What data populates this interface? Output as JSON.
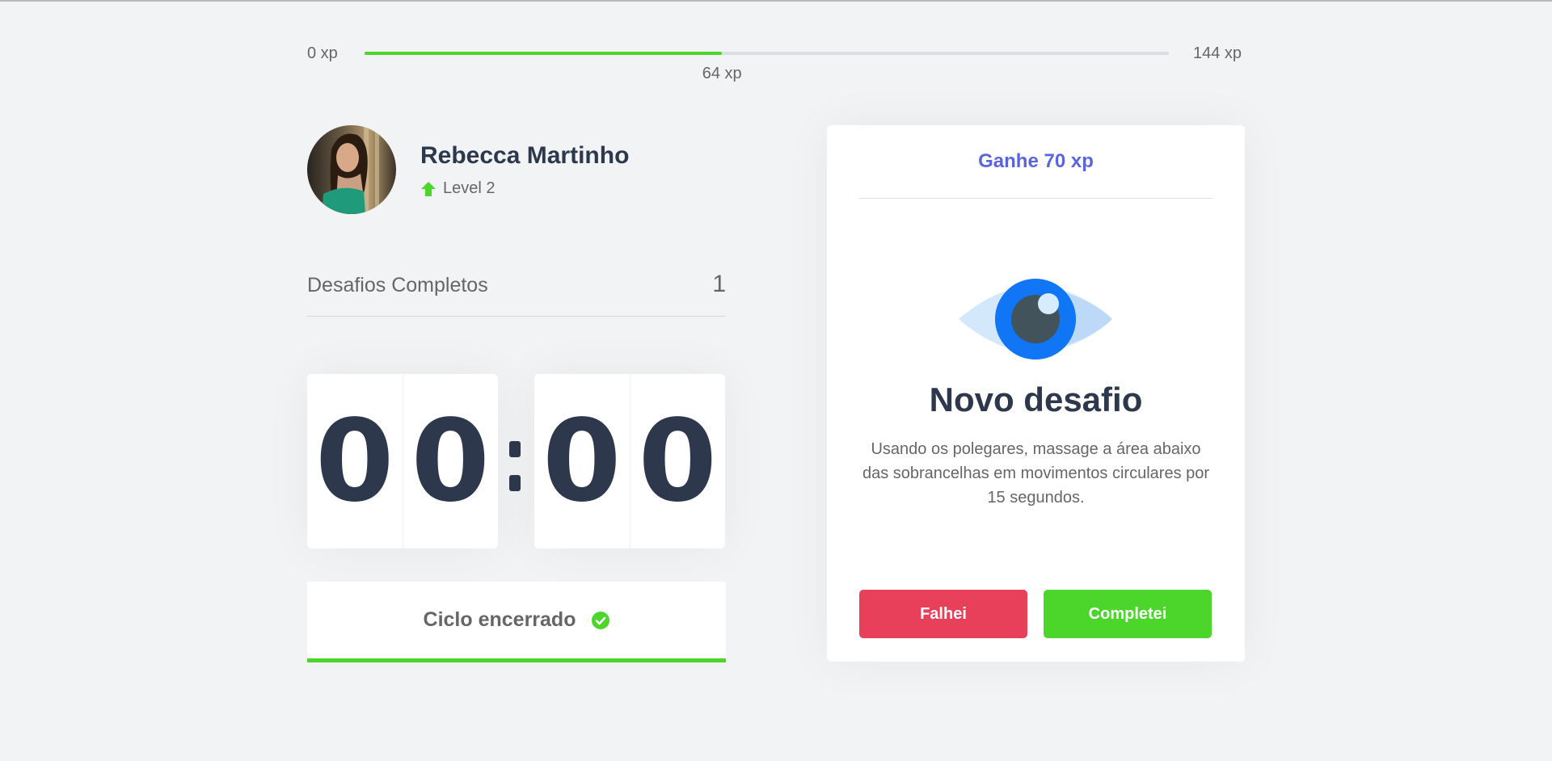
{
  "experience": {
    "min_label": "0 xp",
    "max_label": "144 xp",
    "current_label": "64 xp",
    "current_fraction": 0.4444
  },
  "profile": {
    "name": "Rebecca Martinho",
    "level_label": "Level 2"
  },
  "completed": {
    "label": "Desafios Completos",
    "count": "1"
  },
  "countdown": {
    "minute_left": "0",
    "minute_right": "0",
    "second_left": "0",
    "second_right": "0"
  },
  "cycle_button": {
    "label": "Ciclo encerrado",
    "icon": "check-circle-icon"
  },
  "challenge": {
    "reward": "Ganhe 70 xp",
    "icon": "eye-icon",
    "title": "Novo desafio",
    "description": "Usando os polegares, massage a área abaixo das sobrancelhas em movimentos circulares por 15 segundos.",
    "fail_label": "Falhei",
    "success_label": "Completei"
  },
  "colors": {
    "green": "#4cd62b",
    "red": "#e83f5b",
    "blue": "#5965e0",
    "title": "#2e384d"
  }
}
